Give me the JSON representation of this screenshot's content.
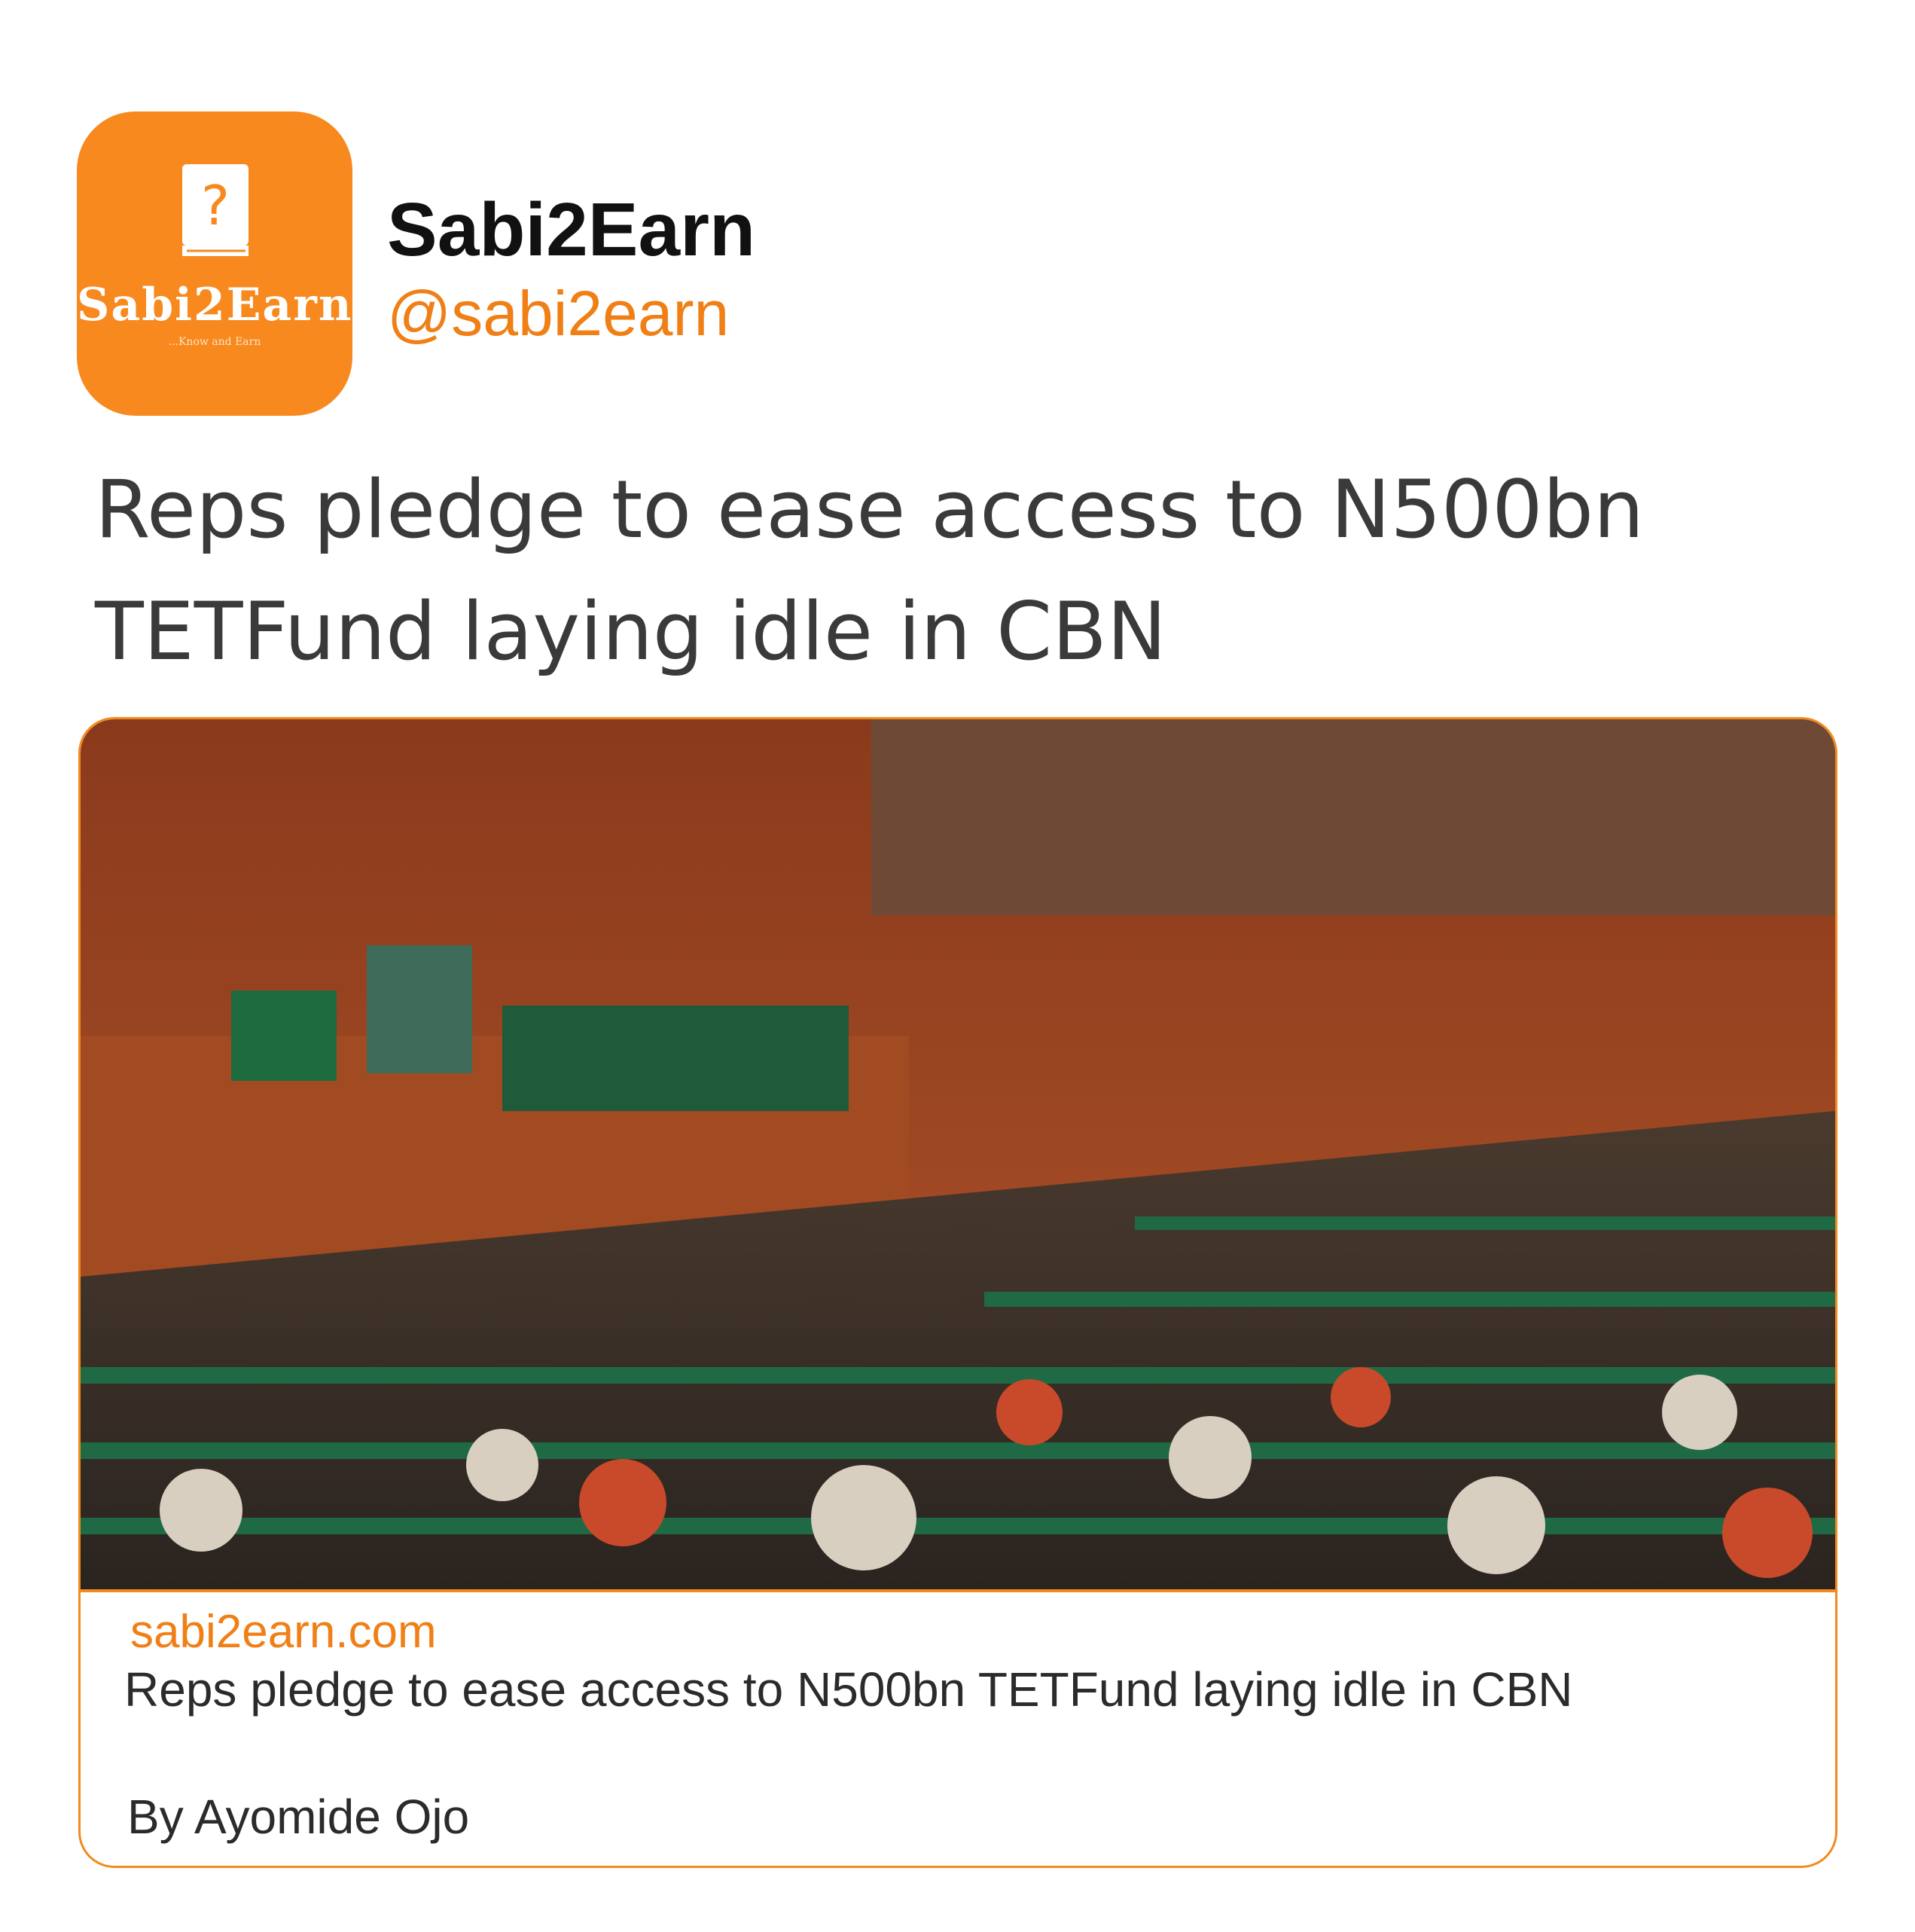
{
  "profile": {
    "avatar_brand": "Sabi2Earn",
    "avatar_tagline": "...Know and Earn",
    "display_name": "Sabi2Earn",
    "handle": "@sabi2earn"
  },
  "post": {
    "headline": "Reps pledge to ease access to N500bn TETFund laying idle in CBN"
  },
  "link_card": {
    "domain": "sabi2earn.com",
    "title": "Reps pledge to ease access to N500bn TETFund laying idle in CBN",
    "author": "By Ayomide Ojo"
  },
  "colors": {
    "brand_orange": "#f7891f",
    "link_orange": "#f07f16",
    "text_dark": "#111111"
  }
}
